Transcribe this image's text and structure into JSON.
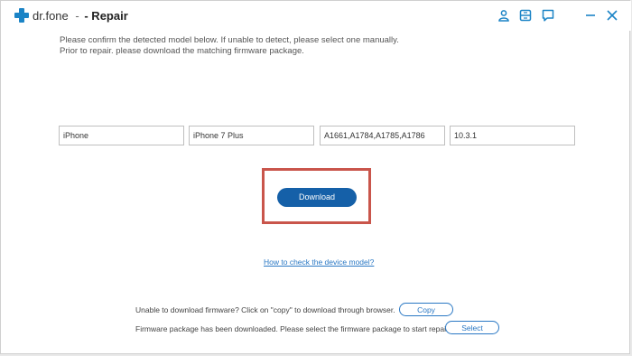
{
  "app": {
    "brand": "dr.fone",
    "separator": "-",
    "title": "- Repair"
  },
  "titlebar_icons": [
    "user-icon",
    "save-icon",
    "feedback-icon",
    "minimize-icon",
    "close-icon"
  ],
  "instructions": {
    "line1": "Please confirm the detected model below. If unable to detect, please select one manually.",
    "line2": "Prior to repair. please download the matching firmware package."
  },
  "fields": {
    "device": "iPhone",
    "model": "iPhone 7 Plus",
    "model_numbers": "A1661,A1784,A1785,A1786",
    "ios_version": "10.3.1"
  },
  "download_label": "Download",
  "howto_link": "How to check the device model?",
  "copy_row": {
    "text": "Unable to download firmware? Click on \"copy\" to download through browser.",
    "button": "Copy"
  },
  "select_row": {
    "text": "Firmware package has been downloaded. Please select the firmware package to start repair.",
    "button": "Select"
  },
  "colors": {
    "brand_blue": "#1b84c6",
    "download_button": "#1560a8",
    "highlight_box": "#c9554b",
    "link_blue": "#2a78c4"
  }
}
